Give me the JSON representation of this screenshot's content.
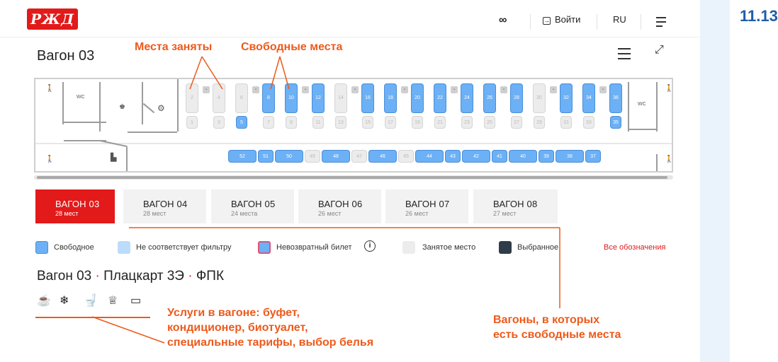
{
  "page_number": "11.13",
  "header": {
    "logo_text": "РЖД",
    "login_label": "Войти",
    "lang_label": "RU"
  },
  "wagon_title": "Вагон 03",
  "annotations": {
    "occupied": "Места заняты",
    "free": "Свободные места",
    "services": [
      "Услуги в вагоне: буфет,",
      "кондиционер, биотуалет,",
      "специальные тарифы, выбор белья"
    ],
    "free_wagons": [
      "Вагоны, в которых",
      "есть свободные места"
    ]
  },
  "map": {
    "wc_left": "WC",
    "wc_right": "WC",
    "upper_seats": [
      {
        "n": "2",
        "free": false
      },
      {
        "n": "4",
        "free": false
      },
      {
        "n": "6",
        "free": false
      },
      {
        "n": "8",
        "free": true
      },
      {
        "n": "10",
        "free": true
      },
      {
        "n": "12",
        "free": true
      },
      {
        "n": "14",
        "free": false
      },
      {
        "n": "16",
        "free": true
      },
      {
        "n": "18",
        "free": true
      },
      {
        "n": "20",
        "free": true
      },
      {
        "n": "22",
        "free": true
      },
      {
        "n": "24",
        "free": true
      },
      {
        "n": "26",
        "free": true
      },
      {
        "n": "28",
        "free": true
      },
      {
        "n": "30",
        "free": false
      },
      {
        "n": "32",
        "free": true
      },
      {
        "n": "34",
        "free": true
      },
      {
        "n": "36",
        "free": true
      }
    ],
    "lower_seats": [
      {
        "n": "1",
        "free": false
      },
      {
        "n": "3",
        "free": false
      },
      {
        "n": "5",
        "free": true
      },
      {
        "n": "7",
        "free": false
      },
      {
        "n": "9",
        "free": false
      },
      {
        "n": "11",
        "free": false
      },
      {
        "n": "13",
        "free": false
      },
      {
        "n": "15",
        "free": false
      },
      {
        "n": "17",
        "free": false
      },
      {
        "n": "19",
        "free": false
      },
      {
        "n": "21",
        "free": false
      },
      {
        "n": "23",
        "free": false
      },
      {
        "n": "25",
        "free": false
      },
      {
        "n": "27",
        "free": false
      },
      {
        "n": "29",
        "free": false
      },
      {
        "n": "31",
        "free": false
      },
      {
        "n": "33",
        "free": false
      },
      {
        "n": "35",
        "free": true
      }
    ],
    "side_seats": [
      {
        "n": "52",
        "free": true
      },
      {
        "n": "51",
        "free": true
      },
      {
        "n": "50",
        "free": true
      },
      {
        "n": "49",
        "free": false
      },
      {
        "n": "48",
        "free": true
      },
      {
        "n": "47",
        "free": false
      },
      {
        "n": "46",
        "free": true
      },
      {
        "n": "45",
        "free": false
      },
      {
        "n": "44",
        "free": true
      },
      {
        "n": "43",
        "free": true
      },
      {
        "n": "42",
        "free": true
      },
      {
        "n": "41",
        "free": true
      },
      {
        "n": "40",
        "free": true
      },
      {
        "n": "39",
        "free": true
      },
      {
        "n": "38",
        "free": true
      },
      {
        "n": "37",
        "free": true
      }
    ]
  },
  "tabs": [
    {
      "name": "ВАГОН 03",
      "seats": "28 мест",
      "active": true
    },
    {
      "name": "ВАГОН 04",
      "seats": "28 мест",
      "active": false
    },
    {
      "name": "ВАГОН 05",
      "seats": "24 места",
      "active": false
    },
    {
      "name": "ВАГОН 06",
      "seats": "26 мест",
      "active": false
    },
    {
      "name": "ВАГОН 07",
      "seats": "26 мест",
      "active": false
    },
    {
      "name": "ВАГОН 08",
      "seats": "27 мест",
      "active": false
    }
  ],
  "legend": {
    "free": "Свободное",
    "not_matching": "Не соответствует фильтру",
    "non_refundable": "Невозвратный билет",
    "occupied": "Занятое место",
    "selected": "Выбранное",
    "all_link": "Все обозначения"
  },
  "subtitle": {
    "wagon": "Вагон 03",
    "class": "Плацкарт 3Э",
    "carrier": "ФПК",
    "sep": "·"
  },
  "services": [
    "buffet-icon",
    "snowflake-icon",
    "toilet-icon",
    "special-tariff-icon",
    "bed-linen-icon"
  ],
  "colors": {
    "brand_red": "#e21a1a",
    "annotation": "#ee5a1c",
    "free_seat": "#6cb0f5",
    "occupied_seat": "#ececec",
    "selected": "#2f3d4a"
  }
}
